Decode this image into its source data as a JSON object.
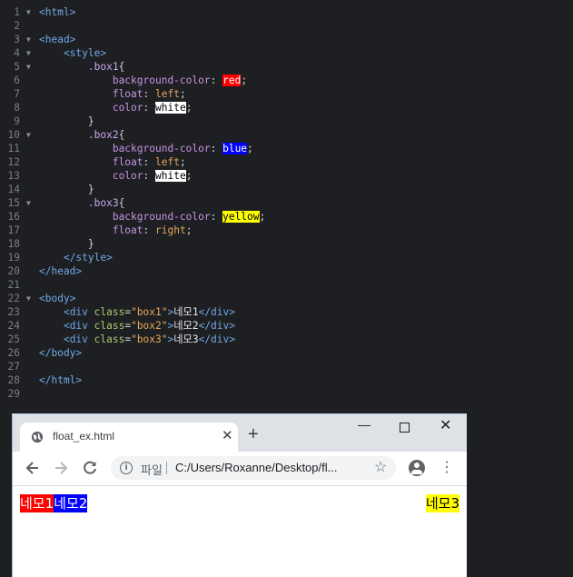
{
  "editor": {
    "lines": [
      {
        "n": "1",
        "fold": true,
        "tokens": [
          {
            "c": "tag",
            "t": "<html>"
          }
        ]
      },
      {
        "n": "2",
        "fold": false,
        "tokens": []
      },
      {
        "n": "3",
        "fold": true,
        "tokens": [
          {
            "c": "tag",
            "t": "<head>"
          }
        ]
      },
      {
        "n": "4",
        "fold": true,
        "tokens": [
          {
            "c": "punc",
            "t": "    "
          },
          {
            "c": "tag",
            "t": "<style>"
          }
        ]
      },
      {
        "n": "5",
        "fold": true,
        "tokens": [
          {
            "c": "punc",
            "t": "        "
          },
          {
            "c": "sel",
            "t": ".box1"
          },
          {
            "c": "punc",
            "t": "{"
          }
        ]
      },
      {
        "n": "6",
        "fold": false,
        "tokens": [
          {
            "c": "punc",
            "t": "            "
          },
          {
            "c": "prop",
            "t": "background-color"
          },
          {
            "c": "punc",
            "t": ": "
          },
          {
            "c": "swatch-red",
            "t": "red"
          },
          {
            "c": "punc",
            "t": ";"
          }
        ]
      },
      {
        "n": "7",
        "fold": false,
        "tokens": [
          {
            "c": "punc",
            "t": "            "
          },
          {
            "c": "prop",
            "t": "float"
          },
          {
            "c": "punc",
            "t": ": "
          },
          {
            "c": "val",
            "t": "left"
          },
          {
            "c": "punc",
            "t": ";"
          }
        ]
      },
      {
        "n": "8",
        "fold": false,
        "tokens": [
          {
            "c": "punc",
            "t": "            "
          },
          {
            "c": "prop",
            "t": "color"
          },
          {
            "c": "punc",
            "t": ": "
          },
          {
            "c": "swatch-white",
            "t": "white"
          },
          {
            "c": "punc",
            "t": ";"
          }
        ]
      },
      {
        "n": "9",
        "fold": false,
        "tokens": [
          {
            "c": "punc",
            "t": "        }"
          }
        ]
      },
      {
        "n": "10",
        "fold": true,
        "tokens": [
          {
            "c": "punc",
            "t": "        "
          },
          {
            "c": "sel",
            "t": ".box2"
          },
          {
            "c": "punc",
            "t": "{"
          }
        ]
      },
      {
        "n": "11",
        "fold": false,
        "tokens": [
          {
            "c": "punc",
            "t": "            "
          },
          {
            "c": "prop",
            "t": "background-color"
          },
          {
            "c": "punc",
            "t": ": "
          },
          {
            "c": "swatch-blue",
            "t": "blue"
          },
          {
            "c": "punc",
            "t": ";"
          }
        ]
      },
      {
        "n": "12",
        "fold": false,
        "tokens": [
          {
            "c": "punc",
            "t": "            "
          },
          {
            "c": "prop",
            "t": "float"
          },
          {
            "c": "punc",
            "t": ": "
          },
          {
            "c": "val",
            "t": "left"
          },
          {
            "c": "punc",
            "t": ";"
          }
        ]
      },
      {
        "n": "13",
        "fold": false,
        "tokens": [
          {
            "c": "punc",
            "t": "            "
          },
          {
            "c": "prop",
            "t": "color"
          },
          {
            "c": "punc",
            "t": ": "
          },
          {
            "c": "swatch-white",
            "t": "white"
          },
          {
            "c": "punc",
            "t": ";"
          }
        ]
      },
      {
        "n": "14",
        "fold": false,
        "tokens": [
          {
            "c": "punc",
            "t": "        }"
          }
        ]
      },
      {
        "n": "15",
        "fold": true,
        "tokens": [
          {
            "c": "punc",
            "t": "        "
          },
          {
            "c": "sel",
            "t": ".box3"
          },
          {
            "c": "punc",
            "t": "{"
          }
        ]
      },
      {
        "n": "16",
        "fold": false,
        "tokens": [
          {
            "c": "punc",
            "t": "            "
          },
          {
            "c": "prop",
            "t": "background-color"
          },
          {
            "c": "punc",
            "t": ": "
          },
          {
            "c": "swatch-yellow",
            "t": "yellow"
          },
          {
            "c": "punc",
            "t": ";"
          }
        ]
      },
      {
        "n": "17",
        "fold": false,
        "tokens": [
          {
            "c": "punc",
            "t": "            "
          },
          {
            "c": "prop",
            "t": "float"
          },
          {
            "c": "punc",
            "t": ": "
          },
          {
            "c": "val",
            "t": "right"
          },
          {
            "c": "punc",
            "t": ";"
          }
        ]
      },
      {
        "n": "18",
        "fold": false,
        "tokens": [
          {
            "c": "punc",
            "t": "        }"
          }
        ]
      },
      {
        "n": "19",
        "fold": false,
        "tokens": [
          {
            "c": "punc",
            "t": "    "
          },
          {
            "c": "tag",
            "t": "</style>"
          }
        ]
      },
      {
        "n": "20",
        "fold": false,
        "tokens": [
          {
            "c": "tag",
            "t": "</head>"
          }
        ]
      },
      {
        "n": "21",
        "fold": false,
        "tokens": []
      },
      {
        "n": "22",
        "fold": true,
        "tokens": [
          {
            "c": "tag",
            "t": "<body>"
          }
        ]
      },
      {
        "n": "23",
        "fold": false,
        "tokens": [
          {
            "c": "punc",
            "t": "    "
          },
          {
            "c": "tag",
            "t": "<div "
          },
          {
            "c": "attr",
            "t": "class"
          },
          {
            "c": "punc",
            "t": "="
          },
          {
            "c": "str",
            "t": "\"box1\""
          },
          {
            "c": "tag",
            "t": ">"
          },
          {
            "c": "kor",
            "t": "네모1"
          },
          {
            "c": "tag",
            "t": "</div>"
          }
        ]
      },
      {
        "n": "24",
        "fold": false,
        "tokens": [
          {
            "c": "punc",
            "t": "    "
          },
          {
            "c": "tag",
            "t": "<div "
          },
          {
            "c": "attr",
            "t": "class"
          },
          {
            "c": "punc",
            "t": "="
          },
          {
            "c": "str",
            "t": "\"box2\""
          },
          {
            "c": "tag",
            "t": ">"
          },
          {
            "c": "kor",
            "t": "네모2"
          },
          {
            "c": "tag",
            "t": "</div>"
          }
        ]
      },
      {
        "n": "25",
        "fold": false,
        "tokens": [
          {
            "c": "punc",
            "t": "    "
          },
          {
            "c": "tag",
            "t": "<div "
          },
          {
            "c": "attr",
            "t": "class"
          },
          {
            "c": "punc",
            "t": "="
          },
          {
            "c": "str",
            "t": "\"box3\""
          },
          {
            "c": "tag",
            "t": ">"
          },
          {
            "c": "kor",
            "t": "네모3"
          },
          {
            "c": "tag",
            "t": "</div>"
          }
        ]
      },
      {
        "n": "26",
        "fold": false,
        "tokens": [
          {
            "c": "tag",
            "t": "</body>"
          }
        ]
      },
      {
        "n": "27",
        "fold": false,
        "tokens": []
      },
      {
        "n": "28",
        "fold": false,
        "tokens": [
          {
            "c": "tag",
            "t": "</html>"
          }
        ]
      },
      {
        "n": "29",
        "fold": false,
        "tokens": []
      }
    ]
  },
  "browser": {
    "tab": {
      "title": "float_ex.html",
      "globe_icon": "globe-icon",
      "close_label": "✕"
    },
    "new_tab_label": "+",
    "window": {
      "minimize": "—",
      "close": "✕"
    },
    "toolbar": {
      "back_icon": "arrow-left-icon",
      "forward_icon": "arrow-right-icon",
      "reload_icon": "reload-icon",
      "info_label": "i",
      "scheme": "파일",
      "url": "C:/Users/Roxanne/Desktop/fl...",
      "star_label": "☆",
      "menu_label": "⋮"
    },
    "page": {
      "box1": "네모1",
      "box2": "네모2",
      "box3": "네모3"
    },
    "colors": {
      "box1": "#ff0000",
      "box2": "#0000ff",
      "box3": "#ffff00"
    }
  }
}
